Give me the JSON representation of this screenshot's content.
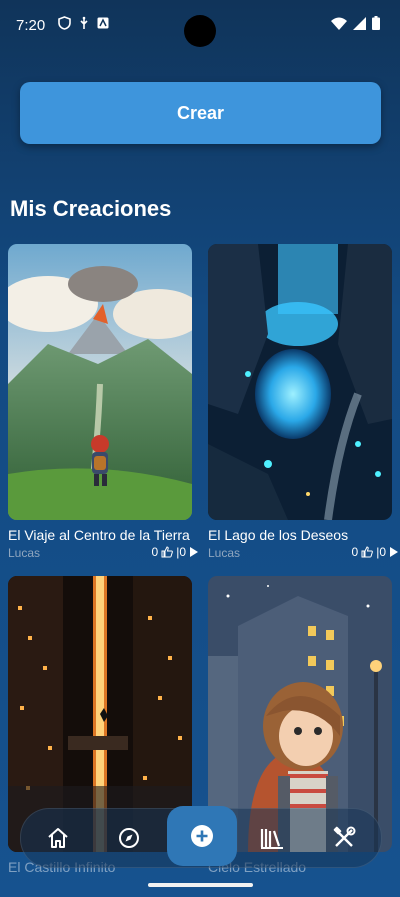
{
  "status_bar": {
    "time": "7:20"
  },
  "main": {
    "create_label": "Crear",
    "section_title": "Mis Creaciones"
  },
  "cards": [
    {
      "title": "El Viaje al Centro de la Tierra",
      "author": "Lucas",
      "likes": "0",
      "plays": "|0"
    },
    {
      "title": "El Lago de los Deseos",
      "author": "Lucas",
      "likes": "0",
      "plays": "|0"
    },
    {
      "title": "El Castillo Infinito",
      "author": "",
      "likes": "",
      "plays": ""
    },
    {
      "title": "Cielo Estrellado",
      "author": "",
      "likes": "",
      "plays": ""
    }
  ],
  "bottom_nav": {
    "items": [
      "home-icon",
      "compass-icon",
      "add-icon",
      "library-icon",
      "tools-icon"
    ]
  },
  "colors": {
    "accent": "#3e95dc",
    "background_top": "#10345a",
    "background_bottom": "#16528f"
  }
}
